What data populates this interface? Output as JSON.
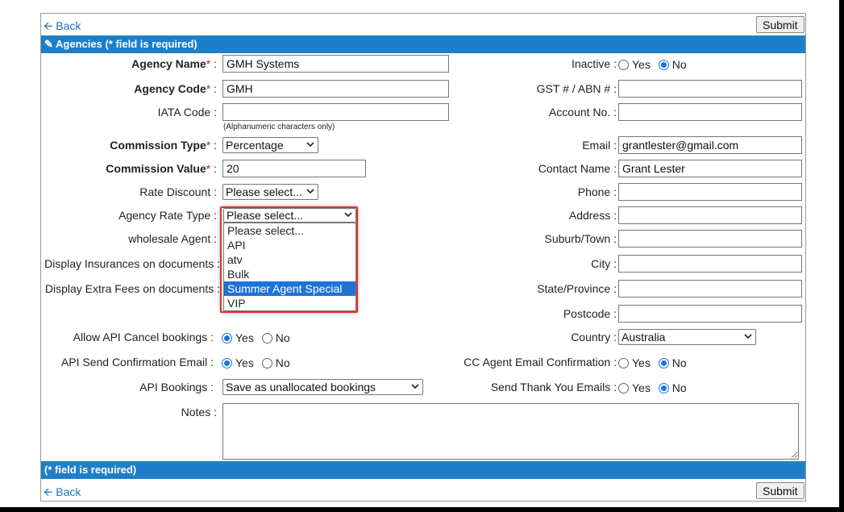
{
  "nav": {
    "back": "Back",
    "submit": "Submit"
  },
  "header": {
    "title": "Agencies (* field is required)"
  },
  "footer": {
    "title": "(* field is required)"
  },
  "left": {
    "agency_name": {
      "label": "Agency Name",
      "value": "GMH Systems"
    },
    "agency_code": {
      "label": "Agency Code",
      "value": "GMH"
    },
    "iata_code": {
      "label": "IATA Code :",
      "value": "",
      "hint": "(Alphanumeric characters only)"
    },
    "commission_type": {
      "label": "Commission Type",
      "value": "Percentage"
    },
    "commission_value": {
      "label": "Commission Value",
      "value": "20"
    },
    "rate_discount": {
      "label": "Rate Discount :",
      "value": "Please select..."
    },
    "agency_rate_type": {
      "label": "Agency Rate Type :",
      "value": "Please select...",
      "options": [
        "Please select...",
        "API",
        "atv",
        "Bulk",
        "Summer Agent Special",
        "VIP"
      ],
      "highlighted": "Summer Agent Special"
    },
    "wholesale_agent": {
      "label": "wholesale Agent :"
    },
    "display_insurances": {
      "label": "Display Insurances on documents :"
    },
    "display_extra_fees": {
      "label": "Display Extra Fees on documents :"
    },
    "allow_api_cancel": {
      "label": "Allow API Cancel bookings :",
      "yes": "Yes",
      "no": "No",
      "selected": "Yes"
    },
    "api_send_confirmation": {
      "label": "API Send Confirmation Email :",
      "yes": "Yes",
      "no": "No",
      "selected": "Yes"
    },
    "api_bookings": {
      "label": "API Bookings :",
      "value": "Save as unallocated bookings"
    },
    "notes": {
      "label": "Notes :",
      "value": ""
    }
  },
  "right": {
    "inactive": {
      "label": "Inactive :",
      "yes": "Yes",
      "no": "No",
      "selected": "No"
    },
    "gst_abn": {
      "label": "GST # / ABN # :",
      "value": ""
    },
    "account_no": {
      "label": "Account No. :",
      "value": ""
    },
    "email": {
      "label": "Email :",
      "value": "grantlester@gmail.com"
    },
    "contact_name": {
      "label": "Contact Name :",
      "value": "Grant Lester"
    },
    "phone": {
      "label": "Phone :",
      "value": ""
    },
    "address": {
      "label": "Address :",
      "value": ""
    },
    "suburb": {
      "label": "Suburb/Town :",
      "value": ""
    },
    "city": {
      "label": "City :",
      "value": ""
    },
    "state": {
      "label": "State/Province :",
      "value": ""
    },
    "postcode": {
      "label": "Postcode :",
      "value": ""
    },
    "country": {
      "label": "Country :",
      "value": "Australia"
    },
    "cc_agent_email": {
      "label": "CC Agent Email Confirmation :",
      "yes": "Yes",
      "no": "No",
      "selected": "No"
    },
    "send_thank_you": {
      "label": "Send Thank You Emails :",
      "yes": "Yes",
      "no": "No",
      "selected": "No"
    }
  },
  "colors": {
    "header_bar": "#1d7fc9",
    "highlight_option": "#1e73d6",
    "callout_border": "#e03030",
    "label_highlight": "#f3f58a",
    "required": "#d02020"
  }
}
